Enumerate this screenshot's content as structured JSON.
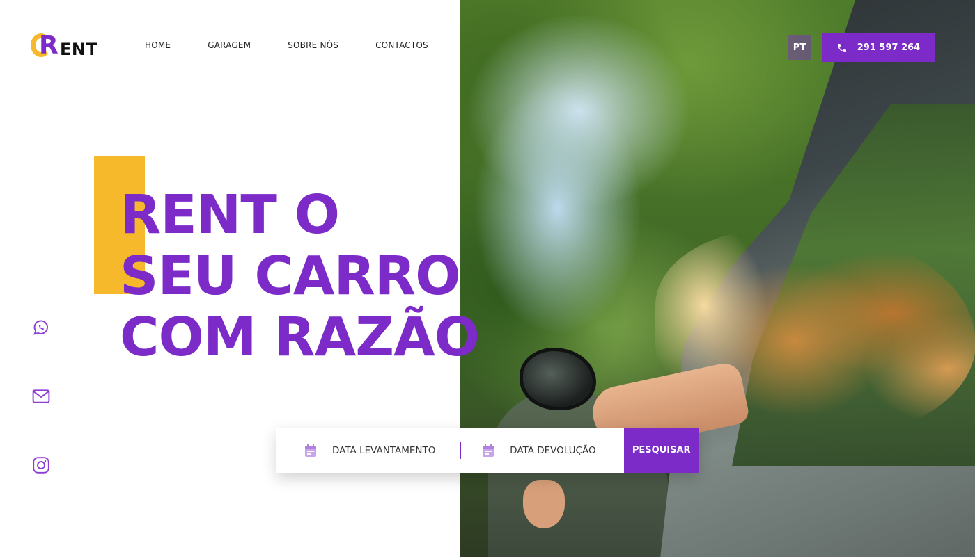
{
  "brand": {
    "logo_text": "ENT",
    "logo_letter": "R",
    "colors": {
      "primary": "#7c2bc9",
      "accent": "#f6b92b"
    }
  },
  "nav": {
    "items": [
      "HOME",
      "GARAGEM",
      "SOBRE NÓS",
      "CONTACTOS"
    ]
  },
  "header": {
    "language": "PT",
    "phone": "291 597 264",
    "phone_icon": "phone-icon"
  },
  "hero": {
    "title_lines": [
      "RENT O",
      "SEU CARRO",
      "COM RAZÃO"
    ]
  },
  "social": [
    {
      "name": "whatsapp",
      "icon": "whatsapp-icon"
    },
    {
      "name": "email",
      "icon": "mail-icon"
    },
    {
      "name": "instagram",
      "icon": "instagram-icon"
    }
  ],
  "search": {
    "pickup_label": "DATA LEVANTAMENTO",
    "return_label": "DATA DEVOLUÇÃO",
    "calendar_icon": "calendar-icon",
    "button_label": "PESQUISAR"
  }
}
